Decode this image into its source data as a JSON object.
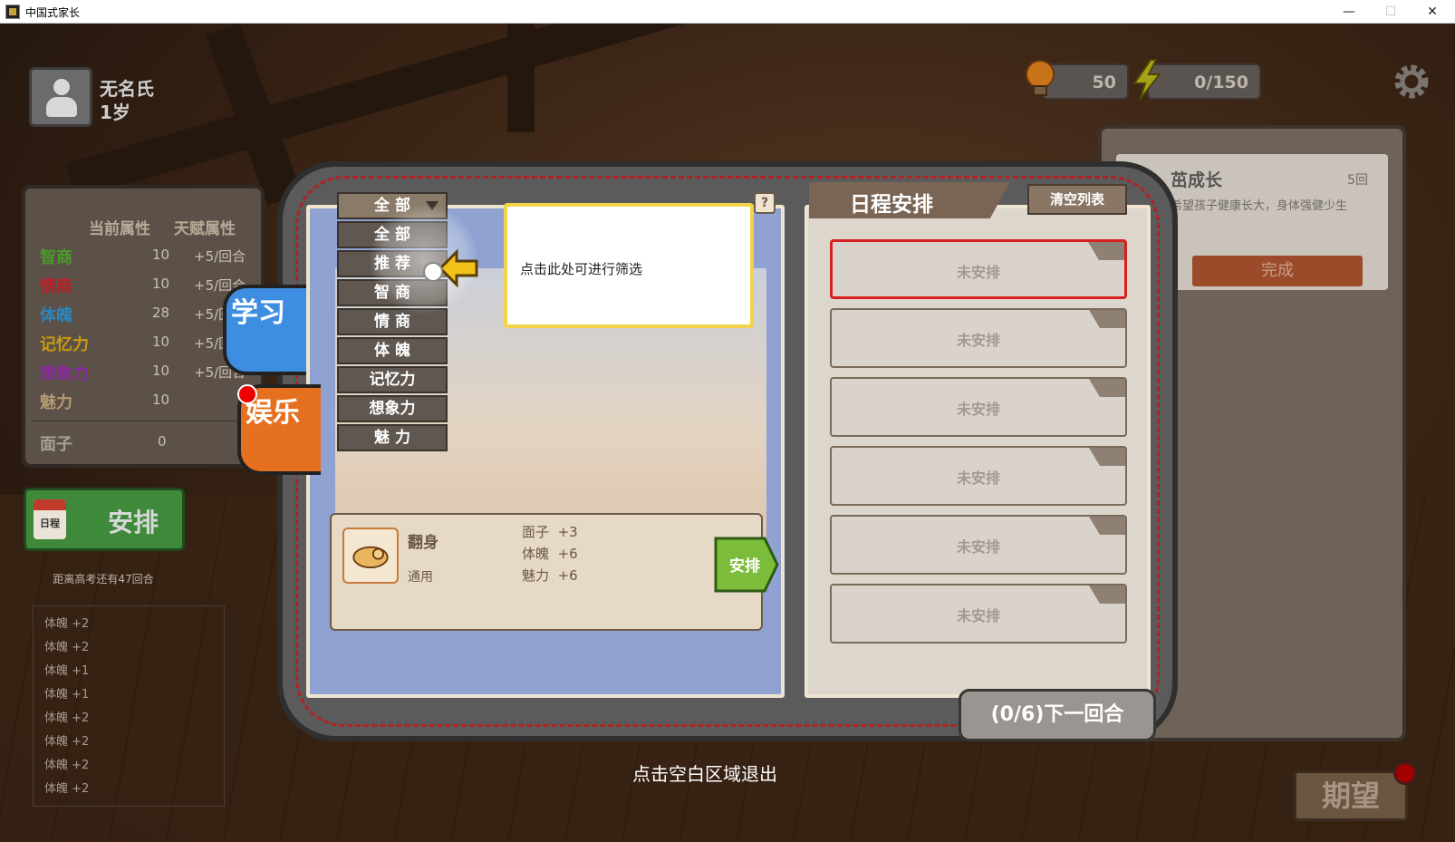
{
  "window": {
    "title": "中国式家长",
    "minimize": "—",
    "maximize": "☐",
    "close": "✕"
  },
  "player": {
    "name": "无名氏",
    "age": "1岁"
  },
  "stats": {
    "header_current": "当前属性",
    "header_talent": "天赋属性",
    "rows": [
      {
        "name": "智商",
        "value": "10",
        "bonus": "+5/回合",
        "color": "#4a9a2a"
      },
      {
        "name": "情商",
        "value": "10",
        "bonus": "+5/回合",
        "color": "#b8202a"
      },
      {
        "name": "体魄",
        "value": "28",
        "bonus": "+5/回合",
        "color": "#2a86c0"
      },
      {
        "name": "记忆力",
        "value": "10",
        "bonus": "+5/回合",
        "color": "#c99a10"
      },
      {
        "name": "想象力",
        "value": "10",
        "bonus": "+5/回合",
        "color": "#8a2aa0"
      },
      {
        "name": "魅力",
        "value": "10",
        "bonus": "",
        "color": "#b49a72"
      }
    ],
    "face_label": "面子",
    "face_value": "0"
  },
  "schedule_button": {
    "calendar_text": "日程",
    "label": "安排"
  },
  "countdown": "距离高考还有47回合",
  "log": [
    "体魄 +2",
    "体魄 +2",
    "体魄 +1",
    "体魄 +1",
    "体魄 +2",
    "体魄 +2",
    "体魄 +2",
    "体魄 +2"
  ],
  "resources": {
    "bulb": "50",
    "energy": "0/150"
  },
  "goal": {
    "title": "茁成长",
    "count": "5回",
    "description": "希望孩子健康长大，身体强健少生",
    "button": "完成"
  },
  "expect_button": "期望",
  "tabs": {
    "study": "学习",
    "fun": "娱乐"
  },
  "filters": {
    "selected": "全 部",
    "options": [
      "全 部",
      "推 荐",
      "智 商",
      "情 商",
      "体 魄",
      "记忆力",
      "想象力",
      "魅 力"
    ]
  },
  "help_label": "?",
  "tip": "点击此处可进行筛选",
  "activity": {
    "name": "翻身",
    "type": "通用",
    "effects": [
      {
        "stat": "面子",
        "value": "+3"
      },
      {
        "stat": "体魄",
        "value": "+6"
      },
      {
        "stat": "魅力",
        "value": "+6"
      }
    ],
    "arrange_label": "安排"
  },
  "schedule": {
    "title": "日程安排",
    "clear_label": "清空列表",
    "slots": [
      "未安排",
      "未安排",
      "未安排",
      "未安排",
      "未安排",
      "未安排"
    ]
  },
  "next_round": "(0/6)下一回合",
  "exit_hint": "点击空白区域退出",
  "colors": {
    "study_tab": "#3d8ee0",
    "fun_tab": "#e57020",
    "tip_border": "#f2d44a",
    "active_slot": "#d92020"
  }
}
